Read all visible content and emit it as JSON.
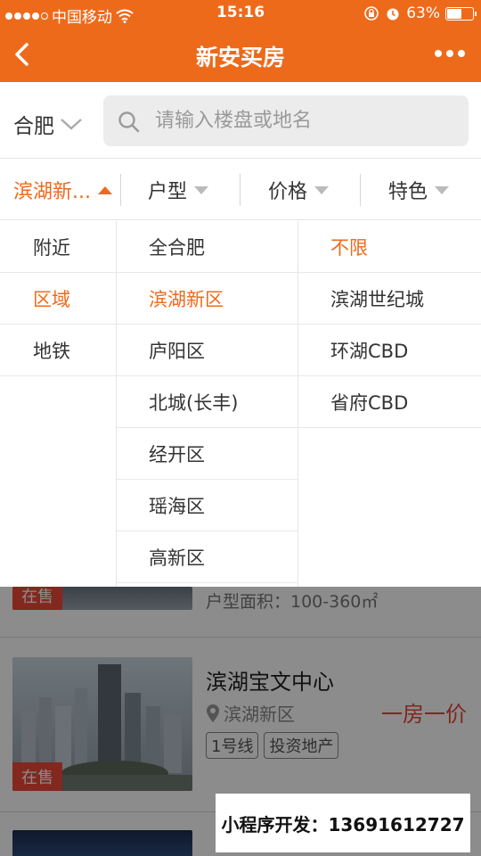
{
  "status": {
    "carrier": "中国移动",
    "time": "15:16",
    "battery": "63%",
    "battery_level": 0.63
  },
  "nav": {
    "title": "新安买房"
  },
  "search": {
    "city": "合肥",
    "placeholder": "请输入楼盘或地名"
  },
  "filters": [
    {
      "label": "滨湖新...",
      "active": true
    },
    {
      "label": "户型",
      "active": false
    },
    {
      "label": "价格",
      "active": false
    },
    {
      "label": "特色",
      "active": false
    }
  ],
  "dropdown": {
    "col1": [
      "附近",
      "区域",
      "地铁"
    ],
    "col2": [
      "全合肥",
      "滨湖新区",
      "庐阳区",
      "北城(长丰)",
      "经开区",
      "瑶海区",
      "高新区"
    ],
    "col3": [
      "不限",
      "滨湖世纪城",
      "环湖CBD",
      "省府CBD"
    ]
  },
  "listing_partial": {
    "area": "户型面积：100-360㎡",
    "badge": "在售"
  },
  "listing": {
    "name": "滨湖宝文中心",
    "location": "滨湖新区",
    "tags": [
      "1号线",
      "投资地产"
    ],
    "price": "一房一价",
    "badge": "在售"
  },
  "promo": {
    "text": "小程序开发：13691612727"
  },
  "colors": {
    "accent": "#ee6a1b",
    "price": "#e8473a"
  }
}
